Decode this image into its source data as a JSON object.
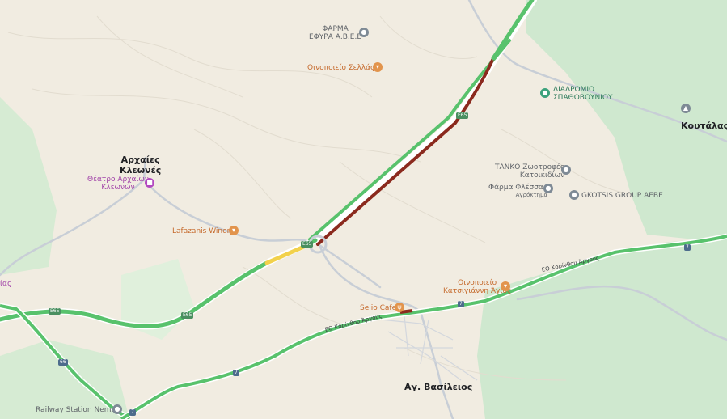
{
  "places": {
    "archaies_kleones_line1": "Αρχαίες",
    "archaies_kleones_line2": "Κλεωνές",
    "koutalas": "Κουτάλας",
    "ag_vasileios": "Αγ. Βασίλειος",
    "left_edge_fragment": "ίας"
  },
  "pois": {
    "farma_efyra_line1": "ΦΑΡΜΑ",
    "farma_efyra_line2": "ΕΦΥΡΑ Α.Β.Ε.Ε",
    "oinopoieio_sellas": "Οινοποιείο Σελλάς",
    "diadromio_line1": "ΔΙΑΔΡΟΜΙΟ",
    "diadromio_line2": "ΣΠΑΘΟΒΟΥΝΙΟΥ",
    "theatro_line1": "Θέατρο Αρχαίων",
    "theatro_line2": "Κλεωνών",
    "tanko_line1": "ΤΑΝΚΟ Ζωοτροφές",
    "tanko_line2": "Κατοικιδίων",
    "farma_flessas": "Φάρμα Φλέσσας",
    "farma_flessas_sub": "Αγρόκτημα",
    "gkotsis": "GKOTSIS GROUP AEBE",
    "lafazanis": "Lafazanis Winery",
    "oinopoieio_katsigianni_line1": "Οινοποιείο",
    "oinopoieio_katsigianni_line2": "Κατσιγιάννη Άγιος",
    "selio_cafe": "Selio Cafe",
    "railway_station": "Railway Station Nemea"
  },
  "roads": {
    "e65": "E65",
    "route7": "7",
    "route66": "66",
    "eo_korinthou_argous": "ΕΟ Κορίνθου Άργους"
  },
  "icons": {
    "generic": "pin-icon",
    "winery": "wine-glass-icon",
    "cafe": "restaurant-icon",
    "theatre": "theatre-icon",
    "park": "park-icon",
    "mountain": "mountain-icon",
    "station": "station-icon"
  },
  "colors": {
    "land": "#f1ece1",
    "greenery": "#cfe8cf",
    "traffic_green": "#58c26c",
    "traffic_yellow": "#f2d14b",
    "traffic_darkred": "#8b2a1e",
    "minor_road": "#c8ced6"
  }
}
